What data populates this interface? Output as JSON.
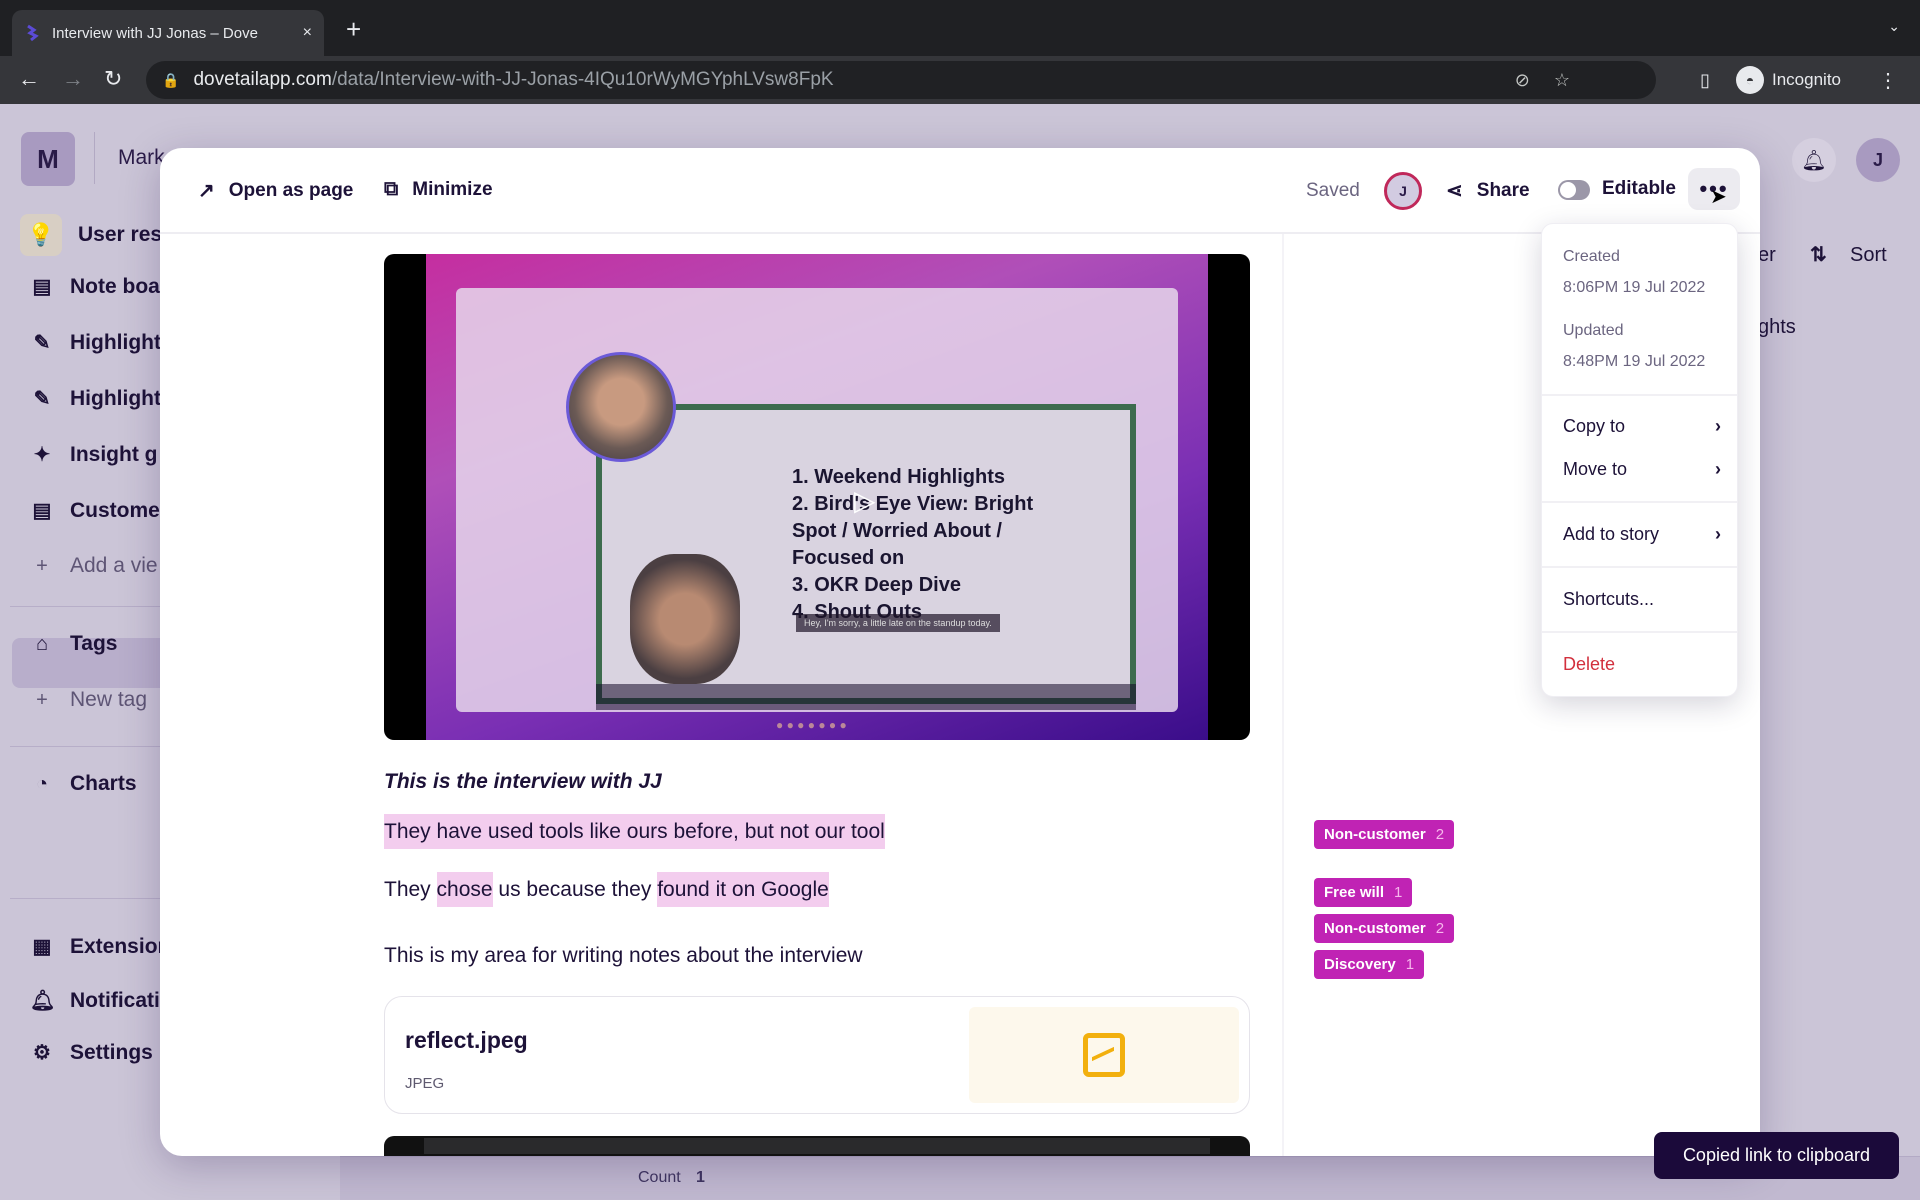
{
  "browser": {
    "tab_title": "Interview with JJ Jonas – Dove",
    "tab_close": "×",
    "new_tab": "+",
    "tab_list": "⌄",
    "back": "←",
    "forward": "→",
    "reload": "↻",
    "url_host": "dovetailapp.com",
    "url_path": "/data/Interview-with-JJ-Jonas-4IQu10rWyMGYphLVsw8FpK",
    "profile_label": "Incognito",
    "menu": "⋮"
  },
  "app": {
    "workspace_initial": "M",
    "workspace_name": "Mark",
    "user_initial": "J",
    "project_name": "User res",
    "sidebar": {
      "items": [
        {
          "label": "Note boa",
          "icon": "note-icon"
        },
        {
          "label": "Highlight",
          "icon": "highlighter-icon"
        },
        {
          "label": "Highlight",
          "icon": "highlighter-icon"
        },
        {
          "label": "Insight g",
          "icon": "sparkle-icon"
        },
        {
          "label": "Custome",
          "icon": "note-icon",
          "active": true
        },
        {
          "label": "Add a vie",
          "icon": "plus-icon"
        }
      ],
      "tags_label": "Tags",
      "new_tag_label": "New tag",
      "charts_label": "Charts",
      "extensions_label": "Extension",
      "notifications_label": "Notificati",
      "settings_label": "Settings"
    },
    "right_toolbar": {
      "filter_partial": "er",
      "sort_label": "Sort",
      "column_partial": "ghts"
    },
    "count_label": "Count",
    "count_value": "1"
  },
  "modal": {
    "open_as_page": "Open as page",
    "minimize": "Minimize",
    "status": "Saved",
    "collaborator_initial": "J",
    "share": "Share",
    "editable_label": "Editable",
    "editable_on": false,
    "more": "•••",
    "video": {
      "slide_lines": [
        "1. Weekend Highlights",
        "2. Bird's Eye View: Bright Spot / Worried About / Focused on",
        "3. OKR Deep Dive",
        "4. Shout Outs"
      ],
      "caption": "Hey, I'm sorry, a little late on the standup today."
    },
    "doc": {
      "title": "This is the interview with JJ",
      "line1_highlight": "They have used tools like ours before, but not our tool",
      "line2_a": "They ",
      "line2_hl1": "chose",
      "line2_b": " us because they ",
      "line2_hl2": "found it on Google",
      "line3": "This is my area for writing notes about the interview"
    },
    "file": {
      "name": "reflect.jpeg",
      "type": "JPEG"
    },
    "tags": [
      {
        "label": "Non-customer",
        "count": "2"
      },
      {
        "label": "Free will",
        "count": "1"
      },
      {
        "label": "Non-customer",
        "count": "2"
      },
      {
        "label": "Discovery",
        "count": "1"
      }
    ],
    "colors": {
      "tag_bg": "#c023b4",
      "highlight_bg": "#f3cdee",
      "danger": "#d2303d"
    }
  },
  "menu": {
    "created_label": "Created",
    "created_value": "8:06PM 19 Jul 2022",
    "updated_label": "Updated",
    "updated_value": "8:48PM 19 Jul 2022",
    "copy_to": "Copy to",
    "move_to": "Move to",
    "add_to_story": "Add to story",
    "shortcuts": "Shortcuts...",
    "delete": "Delete",
    "chevron": "›"
  },
  "toast": {
    "message": "Copied link to clipboard"
  }
}
